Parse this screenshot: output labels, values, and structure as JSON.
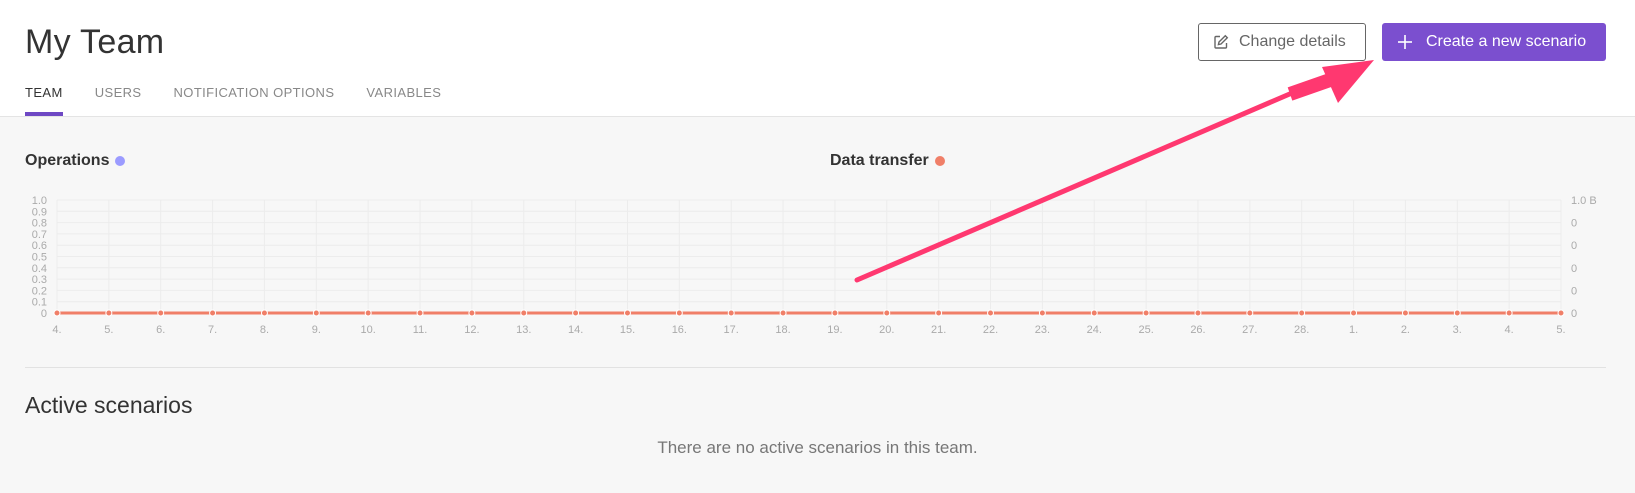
{
  "header": {
    "title": "My Team",
    "tabs": [
      {
        "label": "TEAM",
        "active": true
      },
      {
        "label": "USERS",
        "active": false
      },
      {
        "label": "NOTIFICATION OPTIONS",
        "active": false
      },
      {
        "label": "VARIABLES",
        "active": false
      }
    ],
    "change_details_label": "Change details",
    "create_scenario_label": "Create a new scenario",
    "accent_color": "#7b4fcf"
  },
  "charts": {
    "operations_label": "Operations",
    "operations_color": "#9b9bff",
    "data_transfer_label": "Data transfer",
    "data_transfer_color": "#f07f68"
  },
  "chart_data": {
    "type": "line",
    "x": [
      "4.",
      "5.",
      "6.",
      "7.",
      "8.",
      "9.",
      "10.",
      "11.",
      "12.",
      "13.",
      "14.",
      "15.",
      "16.",
      "17.",
      "18.",
      "19.",
      "20.",
      "21.",
      "22.",
      "23.",
      "24.",
      "25.",
      "26.",
      "27.",
      "28.",
      "1.",
      "2.",
      "3.",
      "4.",
      "5."
    ],
    "series": [
      {
        "name": "Operations",
        "color": "#9b9bff",
        "axis": "left",
        "values": [
          0,
          0,
          0,
          0,
          0,
          0,
          0,
          0,
          0,
          0,
          0,
          0,
          0,
          0,
          0,
          0,
          0,
          0,
          0,
          0,
          0,
          0,
          0,
          0,
          0,
          0,
          0,
          0,
          0,
          0
        ]
      },
      {
        "name": "Data transfer",
        "color": "#f07f68",
        "axis": "right",
        "values": [
          0,
          0,
          0,
          0,
          0,
          0,
          0,
          0,
          0,
          0,
          0,
          0,
          0,
          0,
          0,
          0,
          0,
          0,
          0,
          0,
          0,
          0,
          0,
          0,
          0,
          0,
          0,
          0,
          0,
          0
        ]
      }
    ],
    "y_left_ticks": [
      "0",
      "0.1",
      "0.2",
      "0.3",
      "0.4",
      "0.5",
      "0.6",
      "0.7",
      "0.8",
      "0.9",
      "1.0"
    ],
    "y_right_ticks": [
      "0",
      "0",
      "0",
      "0",
      "0",
      "1.0 B"
    ],
    "ylim": [
      0,
      1
    ],
    "grid": true
  },
  "scenarios": {
    "title": "Active scenarios",
    "empty_message": "There are no active scenarios in this team."
  }
}
